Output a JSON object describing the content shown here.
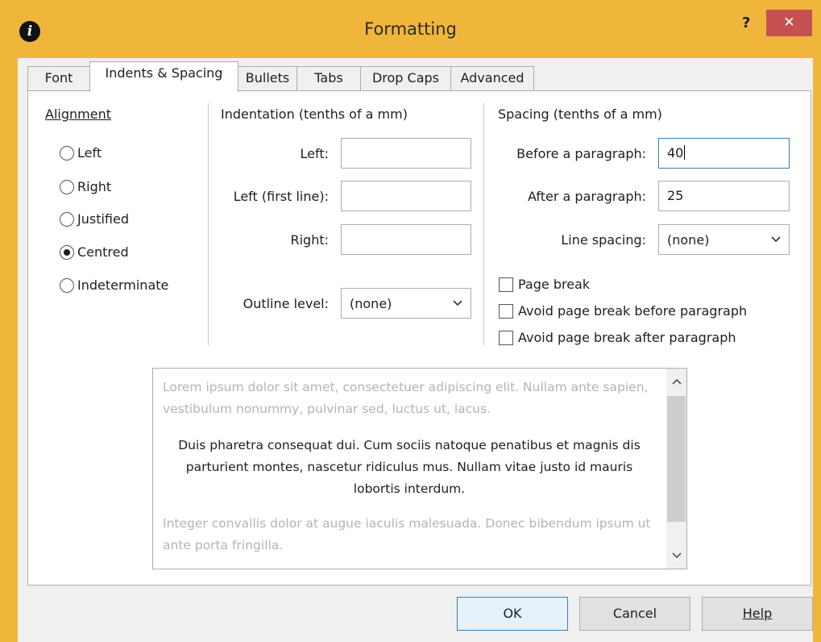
{
  "window": {
    "title": "Formatting",
    "help_label": "?",
    "close_label": "✕",
    "app_icon_label": "i"
  },
  "tabs": [
    {
      "label": "Font",
      "active": false
    },
    {
      "label": "Indents & Spacing",
      "active": true
    },
    {
      "label": "Bullets",
      "active": false
    },
    {
      "label": "Tabs",
      "active": false
    },
    {
      "label": "Drop Caps",
      "active": false
    },
    {
      "label": "Advanced",
      "active": false
    }
  ],
  "alignment": {
    "heading": "Alignment",
    "options": [
      {
        "label": "Left",
        "selected": false
      },
      {
        "label": "Right",
        "selected": false
      },
      {
        "label": "Justified",
        "selected": false
      },
      {
        "label": "Centred",
        "selected": true
      },
      {
        "label": "Indeterminate",
        "selected": false
      }
    ]
  },
  "indentation": {
    "heading": "Indentation (tenths of a mm)",
    "left_label": "Left:",
    "left_value": "",
    "first_line_label": "Left (first line):",
    "first_line_value": "",
    "right_label": "Right:",
    "right_value": "",
    "outline_label": "Outline level:",
    "outline_value": "(none)"
  },
  "spacing": {
    "heading": "Spacing (tenths of a mm)",
    "before_label": "Before a paragraph:",
    "before_value": "40",
    "after_label": "After a paragraph:",
    "after_value": "25",
    "line_label": "Line spacing:",
    "line_value": "(none)"
  },
  "options": {
    "page_break": "Page break",
    "avoid_before": "Avoid page break before paragraph",
    "avoid_after": "Avoid page break after paragraph"
  },
  "preview": {
    "before_text": "Lorem ipsum dolor sit amet, consectetuer adipiscing elit. Nullam ante sapien, vestibulum nonummy, pulvinar sed, luctus ut, lacus.",
    "main_text": "Duis pharetra consequat dui. Cum sociis natoque penatibus et magnis dis parturient montes, nascetur ridiculus mus. Nullam vitae justo id mauris lobortis interdum.",
    "after_text": "Integer convallis dolor at augue iaculis malesuada. Donec bibendum ipsum ut ante porta fringilla."
  },
  "buttons": {
    "ok": "OK",
    "cancel": "Cancel",
    "help": "Help"
  },
  "colors": {
    "frame": "#f0b63c",
    "close": "#c75050",
    "focus": "#3c7fb1"
  }
}
